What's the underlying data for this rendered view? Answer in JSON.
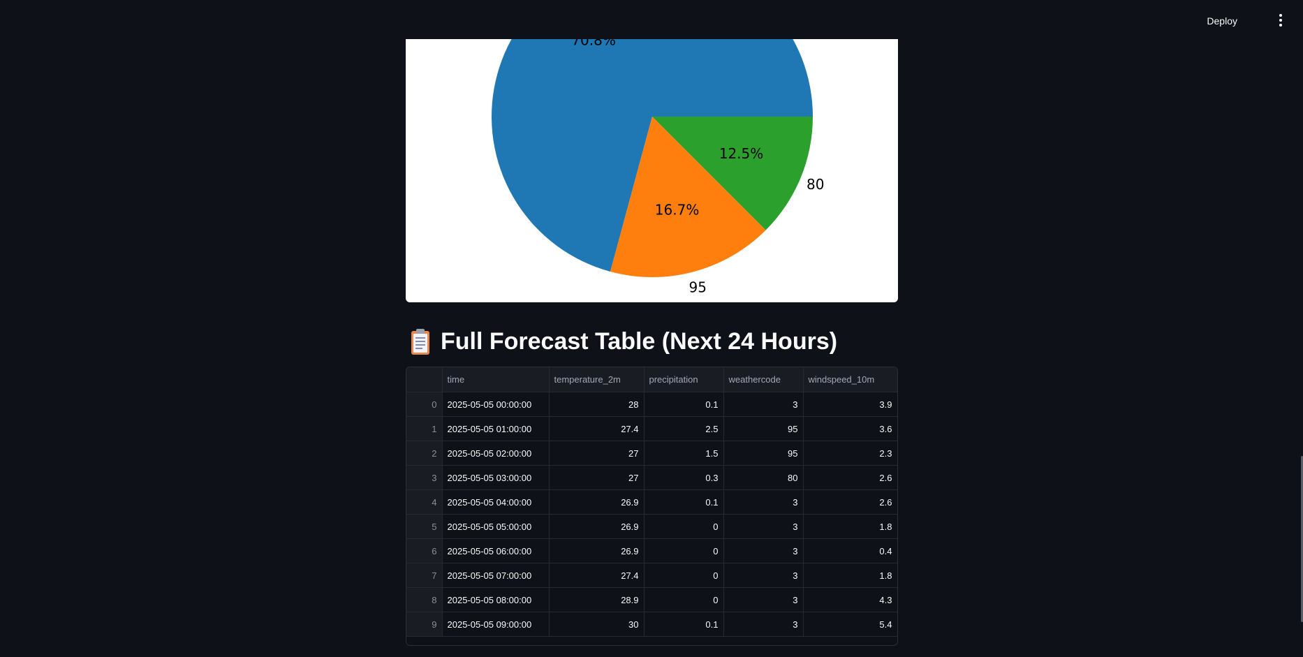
{
  "header": {
    "deploy_label": "Deploy"
  },
  "chart_data": {
    "type": "pie",
    "slices": [
      {
        "label": "",
        "pct_label": "70.8%",
        "value": 70.8,
        "color": "#1f77b4"
      },
      {
        "label": "95",
        "pct_label": "16.7%",
        "value": 16.7,
        "color": "#ff7f0e"
      },
      {
        "label": "80",
        "pct_label": "12.5%",
        "value": 12.5,
        "color": "#2ca02c"
      }
    ]
  },
  "section": {
    "icon": "clipboard-icon",
    "title": "Full Forecast Table (Next 24 Hours)"
  },
  "table": {
    "columns": [
      "",
      "time",
      "temperature_2m",
      "precipitation",
      "weathercode",
      "windspeed_10m"
    ],
    "rows": [
      [
        "0",
        "2025-05-05 00:00:00",
        "28",
        "0.1",
        "3",
        "3.9"
      ],
      [
        "1",
        "2025-05-05 01:00:00",
        "27.4",
        "2.5",
        "95",
        "3.6"
      ],
      [
        "2",
        "2025-05-05 02:00:00",
        "27",
        "1.5",
        "95",
        "2.3"
      ],
      [
        "3",
        "2025-05-05 03:00:00",
        "27",
        "0.3",
        "80",
        "2.6"
      ],
      [
        "4",
        "2025-05-05 04:00:00",
        "26.9",
        "0.1",
        "3",
        "2.6"
      ],
      [
        "5",
        "2025-05-05 05:00:00",
        "26.9",
        "0",
        "3",
        "1.8"
      ],
      [
        "6",
        "2025-05-05 06:00:00",
        "26.9",
        "0",
        "3",
        "0.4"
      ],
      [
        "7",
        "2025-05-05 07:00:00",
        "27.4",
        "0",
        "3",
        "1.8"
      ],
      [
        "8",
        "2025-05-05 08:00:00",
        "28.9",
        "0",
        "3",
        "4.3"
      ],
      [
        "9",
        "2025-05-05 09:00:00",
        "30",
        "0.1",
        "3",
        "5.4"
      ]
    ]
  }
}
